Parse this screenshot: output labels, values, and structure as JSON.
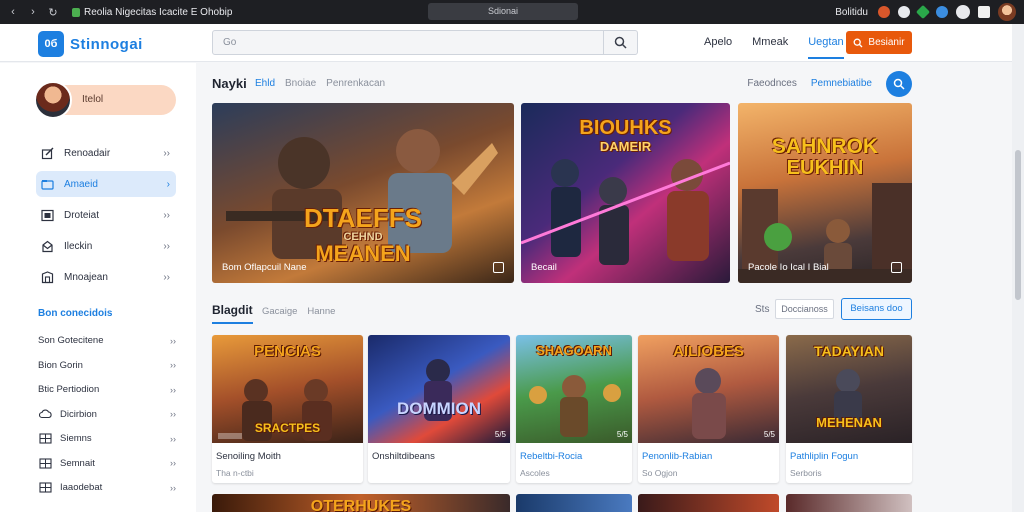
{
  "browser": {
    "tab_title": "Reolia Nigecitas Icacite E Ohobip",
    "address": "Sdionai",
    "profile_label": "Bolitidu"
  },
  "header": {
    "logo_text": "0б",
    "brand": "Stinnogai",
    "search_placeholder": "Go",
    "nav": [
      "Apelo",
      "Mmeak",
      "Uegtan"
    ],
    "active_nav": "Uegtan",
    "cta_label": "Besianir"
  },
  "sidebar": {
    "profile_name": "Itelol",
    "items": [
      {
        "label": "Renoadair",
        "icon": "edit-icon",
        "active": false
      },
      {
        "label": "Amaeid",
        "icon": "folder-icon",
        "active": true
      },
      {
        "label": "Droteiat",
        "icon": "image-icon",
        "active": false
      },
      {
        "label": "Ileckin",
        "icon": "mail-icon",
        "active": false
      },
      {
        "label": "Mnoajean",
        "icon": "store-icon",
        "active": false
      }
    ],
    "section_title": "Bon conecidois",
    "subitems": [
      {
        "label": "Son Gotecitene",
        "icon": ""
      },
      {
        "label": "Bion Gorin",
        "icon": ""
      },
      {
        "label": "Btic Pertiodion",
        "icon": ""
      },
      {
        "label": "Dicirbion",
        "icon": "cloud-icon"
      },
      {
        "label": "Siemns",
        "icon": "grid-icon"
      },
      {
        "label": "Semnait",
        "icon": "grid-icon"
      },
      {
        "label": "Iaaodebat",
        "icon": "grid-icon"
      }
    ]
  },
  "featured": {
    "title": "Nayki",
    "tabs": [
      "Ehld",
      "Bnoiae",
      "Penrenkacan"
    ],
    "active_tab": "Ehld",
    "right_links": [
      "Faeodnces",
      "Pemnebiatibe"
    ],
    "cards": [
      {
        "art_title": "DTAEFFS",
        "art_sub": "CEHND",
        "art_line3": "MEANEN",
        "caption": "Bom Oflapcuil Nane"
      },
      {
        "art_title": "BIOUHKS",
        "art_sub": "DAMEIR",
        "art_line3": "",
        "caption": "Becail"
      },
      {
        "art_title": "SAHNROK",
        "art_sub": "EUKHIN",
        "art_line3": "",
        "caption": "Pacole Io Ical I Bial"
      }
    ]
  },
  "grid": {
    "title": "Blagdit",
    "tabs": [
      "Gacaige",
      "Hanne"
    ],
    "sort_label": "Sts",
    "select_value": "Doccianoss",
    "button_label": "Beisans doo",
    "cards": [
      {
        "art": "PENCIAS",
        "art2": "SRACTPES",
        "title": "Senoiling Moith",
        "sub": "Tha n-ctbi",
        "blue": false,
        "badge": ""
      },
      {
        "art": "DOMMION",
        "art2": "",
        "title": "Onshiltdibeans",
        "sub": "",
        "blue": false,
        "badge": "5/5"
      },
      {
        "art": "SHAGOARN",
        "art2": "",
        "title": "Rebeltbi-Rocia",
        "sub": "Ascoles",
        "blue": true,
        "badge": "5/5"
      },
      {
        "art": "AILIOBES",
        "art2": "",
        "title": "Penonlib-Rabian",
        "sub": "So Ogjon",
        "blue": true,
        "badge": "5/5"
      },
      {
        "art": "TADAYIAN",
        "art2": "MEHENAN",
        "title": "Pathliplin Fogun",
        "sub": "Serboris",
        "blue": true,
        "badge": ""
      }
    ],
    "peek_art": "OTERHUKES"
  },
  "colors": {
    "accent": "#1d7fe0",
    "cta": "#e8590c",
    "profile_bg": "#fbd8c3"
  }
}
